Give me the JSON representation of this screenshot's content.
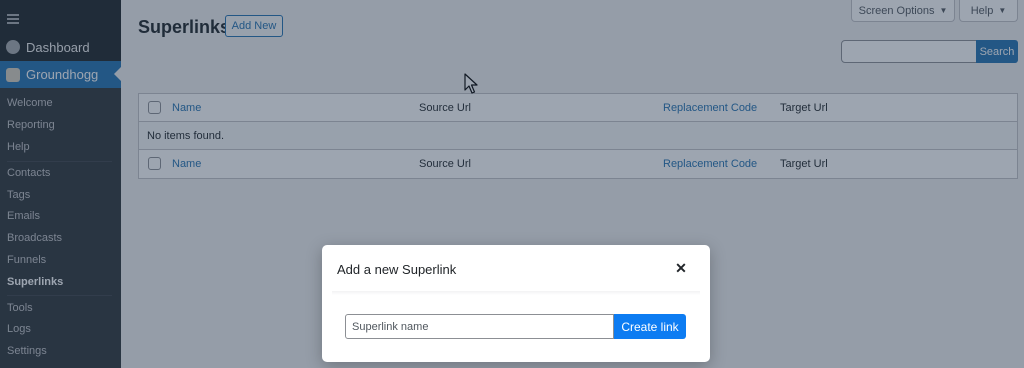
{
  "sidebar": {
    "dashboard_label": "Dashboard",
    "plugin_label": "Groundhogg",
    "submenu": [
      {
        "label": "Welcome"
      },
      {
        "label": "Reporting"
      },
      {
        "label": "Help"
      },
      {
        "label": "Contacts"
      },
      {
        "label": "Tags"
      },
      {
        "label": "Emails"
      },
      {
        "label": "Broadcasts"
      },
      {
        "label": "Funnels"
      },
      {
        "label": "Superlinks",
        "current": true
      },
      {
        "label": "Tools"
      },
      {
        "label": "Logs"
      },
      {
        "label": "Settings"
      }
    ]
  },
  "header": {
    "title": "Superlinks",
    "add_new_label": "Add New",
    "screen_options_label": "Screen Options",
    "help_label": "Help",
    "search_button_label": "Search"
  },
  "table": {
    "columns": [
      "Name",
      "Source Url",
      "Replacement Code",
      "Target Url"
    ],
    "empty_message": "No items found."
  },
  "modal": {
    "title": "Add a new Superlink",
    "close_icon": "close-icon",
    "input_placeholder": "Superlink name",
    "input_value": "",
    "submit_label": "Create link"
  },
  "colors": {
    "accent": "#2271b1",
    "sidebar_bg": "#1d2327",
    "modal_button": "#0d7cf2"
  }
}
